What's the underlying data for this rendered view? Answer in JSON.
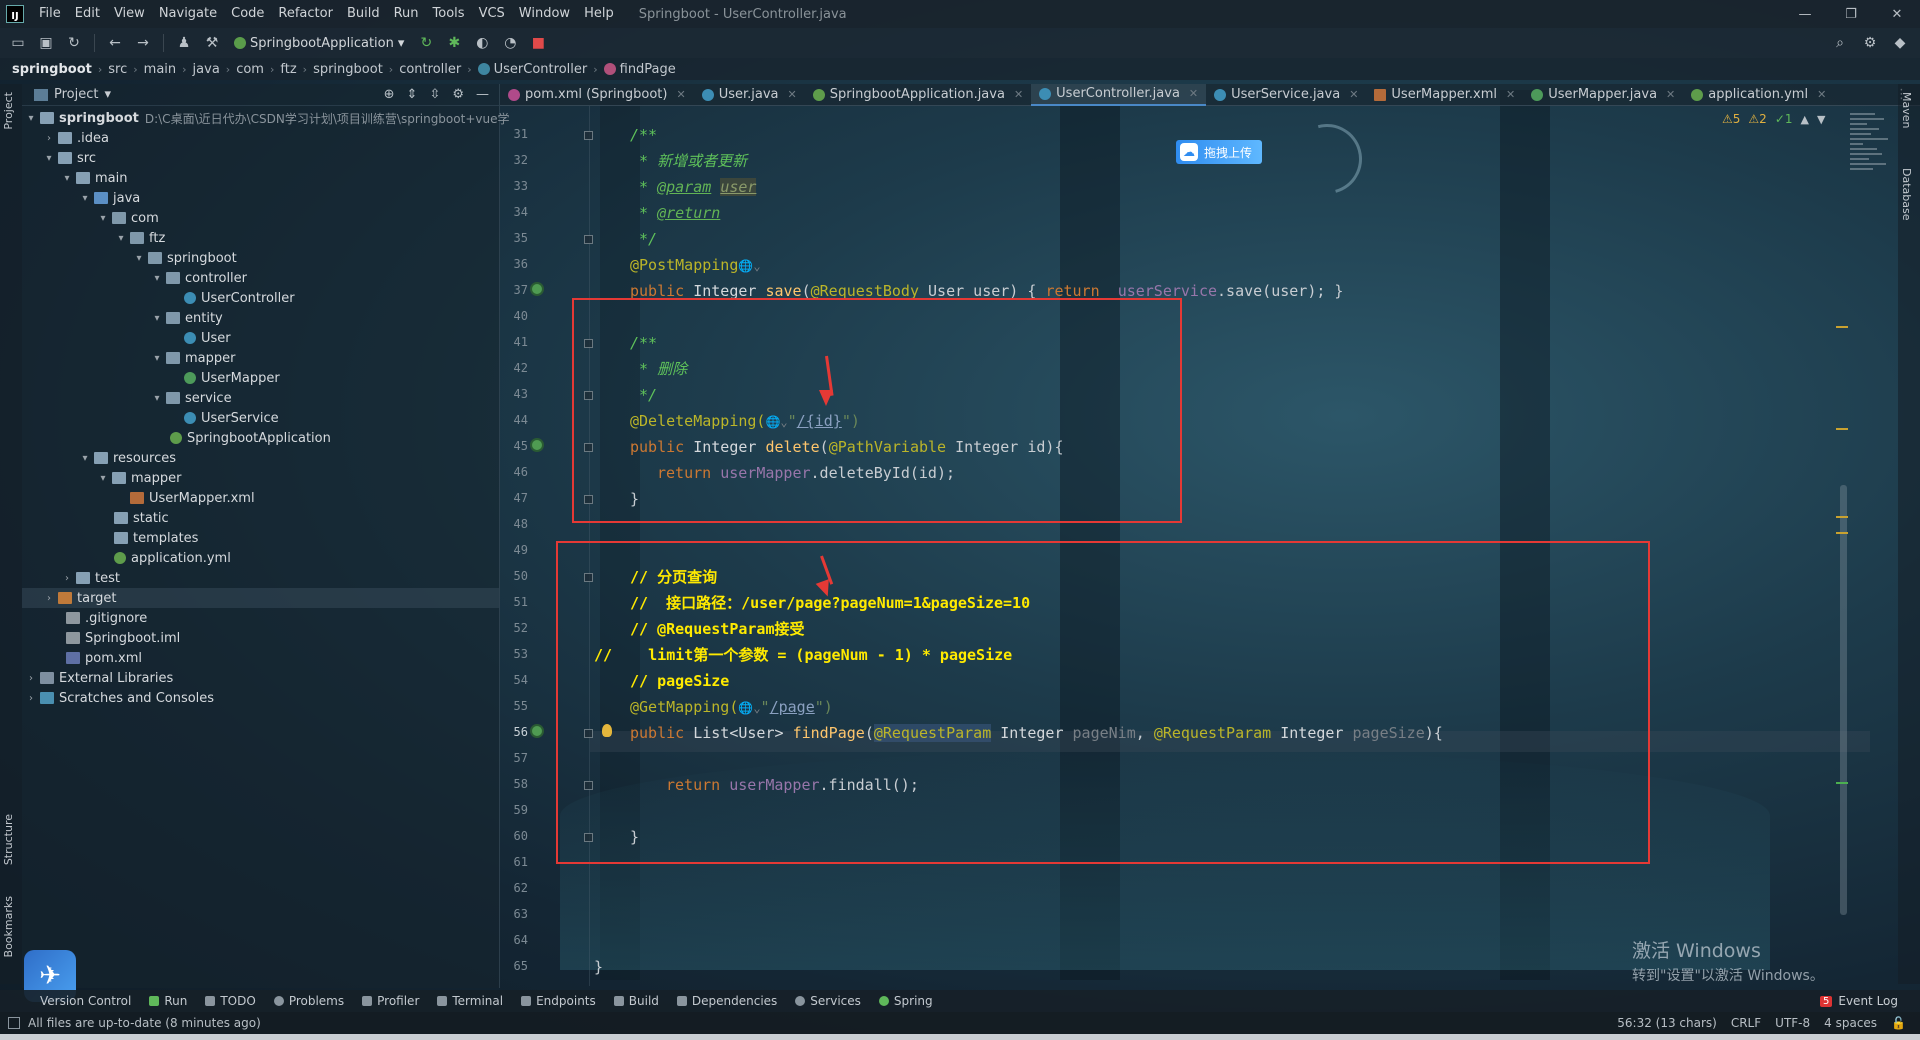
{
  "menu": {
    "logo": "IJ",
    "items": [
      "File",
      "Edit",
      "View",
      "Navigate",
      "Code",
      "Refactor",
      "Build",
      "Run",
      "Tools",
      "VCS",
      "Window",
      "Help"
    ],
    "title": "Springboot - UserController.java",
    "min": "—",
    "max": "❐",
    "close": "✕"
  },
  "toolbar": {
    "run_config": "SpringbootApplication"
  },
  "breadcrumb": [
    "springboot",
    "src",
    "main",
    "java",
    "com",
    "ftz",
    "springboot",
    "controller",
    "UserController",
    "findPage"
  ],
  "left_stripe": {
    "project": "Project",
    "structure": "Structure",
    "bookmarks": "Bookmarks"
  },
  "right_stripe": {
    "maven": "Maven",
    "database": "Database"
  },
  "project_panel": {
    "title": "Project",
    "root_name": "springboot",
    "root_path": "D:\\C桌面\\近日代办\\CSDN学习计划\\项目训练营\\springboot+vue学",
    "tree": [
      {
        "label": ".idea"
      },
      {
        "label": "src"
      },
      {
        "label": "main"
      },
      {
        "label": "java"
      },
      {
        "label": "com"
      },
      {
        "label": "ftz"
      },
      {
        "label": "springboot"
      },
      {
        "label": "controller"
      },
      {
        "label": "UserController"
      },
      {
        "label": "entity"
      },
      {
        "label": "User"
      },
      {
        "label": "mapper"
      },
      {
        "label": "UserMapper"
      },
      {
        "label": "service"
      },
      {
        "label": "UserService"
      },
      {
        "label": "SpringbootApplication"
      },
      {
        "label": "resources"
      },
      {
        "label": "mapper"
      },
      {
        "label": "UserMapper.xml"
      },
      {
        "label": "static"
      },
      {
        "label": "templates"
      },
      {
        "label": "application.yml"
      },
      {
        "label": "test"
      },
      {
        "label": "target"
      },
      {
        "label": ".gitignore"
      },
      {
        "label": "Springboot.iml"
      },
      {
        "label": "pom.xml"
      },
      {
        "label": "External Libraries"
      },
      {
        "label": "Scratches and Consoles"
      }
    ]
  },
  "tabs": [
    {
      "label": "pom.xml (Springboot)",
      "color": "#b04a8a"
    },
    {
      "label": "User.java",
      "color": "#3c8db4"
    },
    {
      "label": "SpringbootApplication.java",
      "color": "#5e9c4b"
    },
    {
      "label": "UserController.java",
      "color": "#3c8db4"
    },
    {
      "label": "UserService.java",
      "color": "#3c8db4"
    },
    {
      "label": "UserMapper.xml",
      "color": "#b46b3a"
    },
    {
      "label": "UserMapper.java",
      "color": "#4d9a5a"
    },
    {
      "label": "application.yml",
      "color": "#5e9c4b"
    }
  ],
  "inspections": {
    "warnings": "⚠5",
    "weak": "⚠2",
    "ok": "✓1"
  },
  "upload_button": "拖拽上传",
  "line_numbers": [
    "31",
    "32",
    "33",
    "34",
    "35",
    "36",
    "37",
    "40",
    "41",
    "42",
    "43",
    "44",
    "45",
    "46",
    "47",
    "48",
    "49",
    "50",
    "51",
    "52",
    "53",
    "54",
    "55",
    "56",
    "57",
    "58",
    "59",
    "60",
    "61",
    "62",
    "63",
    "64",
    "65"
  ],
  "code": {
    "l31": "/**",
    "l32": " * 新增或者更新",
    "l33_a": " * ",
    "l33_b": "@param",
    "l33_c": " ",
    "l33_d": "user",
    "l34_a": " * ",
    "l34_b": "@return",
    "l35": " */",
    "l36_a": "@PostMapping",
    "l36_b": "🌐⌄",
    "l37": [
      "public ",
      "Integer ",
      "save",
      "(",
      "@RequestBody ",
      "User user) { ",
      "return  ",
      "userService",
      ".save(user); }"
    ],
    "l41": "/**",
    "l42": " * 删除",
    "l43": " */",
    "l44": [
      "@DeleteMapping(",
      "🌐⌄",
      "\"",
      "/{id}",
      "\")"
    ],
    "l45": [
      "public ",
      "Integer ",
      "delete",
      "(",
      "@PathVariable ",
      "Integer id){"
    ],
    "l46": [
      "return ",
      "userMapper",
      ".deleteById(id);"
    ],
    "l47": "}",
    "l50": "// 分页查询",
    "l51": "//  接口路径：/user/page?pageNum=1&pageSize=10",
    "l52": "// @RequestParam接受",
    "l53": "//    limit第一个参数 = (pageNum - 1) * pageSize",
    "l54": "// pageSize",
    "l55": [
      "@GetMapping(",
      "🌐⌄",
      "\"",
      "/page",
      "\")"
    ],
    "l56": [
      "public ",
      "List<User> ",
      "findPage",
      "(",
      "@RequestParam",
      " Integer ",
      "pageNim",
      ", ",
      "@RequestParam",
      " Integer ",
      "pageSize",
      "){"
    ],
    "l58": [
      "return ",
      "userMapper",
      ".findall();"
    ],
    "l60": "}",
    "l65": "}"
  },
  "watermark": {
    "line1": "激活 Windows",
    "line2": "转到\"设置\"以激活 Windows。"
  },
  "toolwindows": [
    "Version Control",
    "Run",
    "TODO",
    "Problems",
    "Profiler",
    "Terminal",
    "Endpoints",
    "Build",
    "Dependencies",
    "Services",
    "Spring"
  ],
  "event_log": {
    "count": "5",
    "label": "Event Log"
  },
  "status": {
    "message": "All files are up-to-date (8 minutes ago)",
    "position": "56:32 (13 chars)",
    "line_sep": "CRLF",
    "encoding": "UTF-8",
    "indent": "4 spaces"
  },
  "colors": {
    "highlight_box": "#e53935",
    "accent": "#4a88c7"
  }
}
